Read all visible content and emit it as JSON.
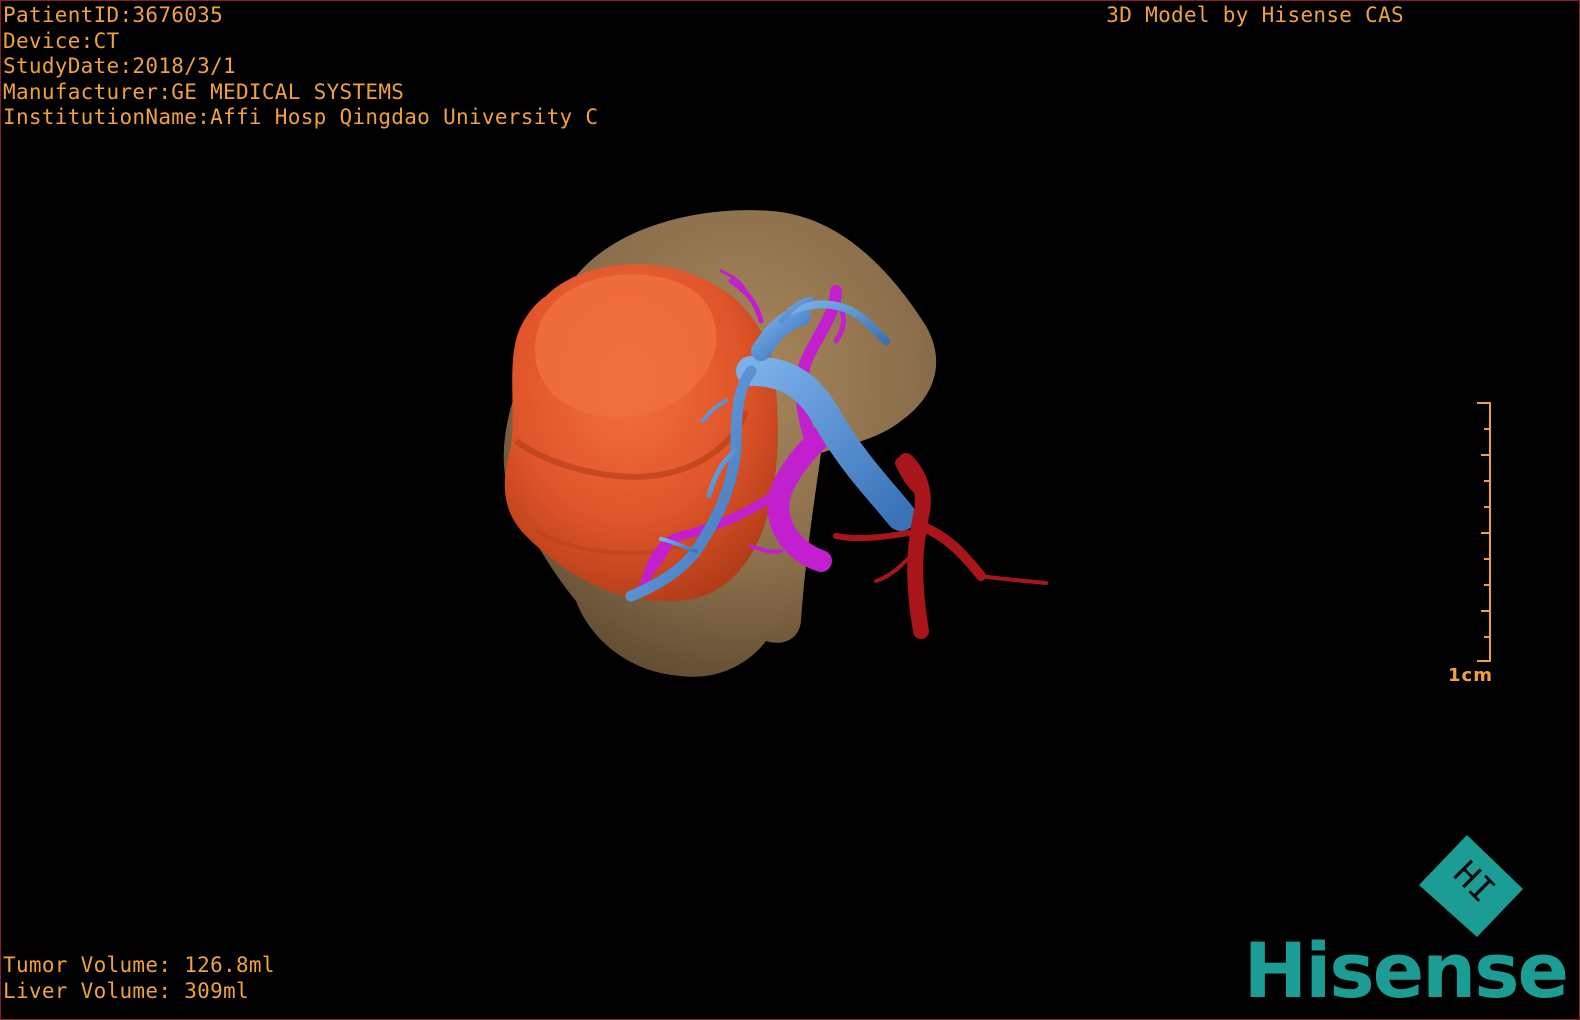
{
  "meta": {
    "patient_id": "PatientID:3676035",
    "device": "Device:CT",
    "study_date": "StudyDate:2018/3/1",
    "manufacturer": "Manufacturer:GE MEDICAL SYSTEMS",
    "institution": "InstitutionName:Affi Hosp Qingdao University C"
  },
  "credit": "3D Model by Hisense CAS",
  "volumes": {
    "tumor": "Tumor Volume: 126.8ml",
    "liver": "Liver Volume: 309ml"
  },
  "scale": {
    "label": "1cm"
  },
  "logo": {
    "wordmark": "Hisense",
    "mark_text": "HI"
  },
  "colors": {
    "overlay_text": "#f0a23a",
    "liver": "#8a6e4b",
    "tumor": "#e0552a",
    "portal_vein": "#4f8fd6",
    "hepatic_vein": "#c21fcf",
    "artery": "#a8151b",
    "brand": "#1b9c94"
  },
  "model_parts": [
    "liver",
    "tumor",
    "portal-vein",
    "hepatic-vein",
    "artery"
  ]
}
